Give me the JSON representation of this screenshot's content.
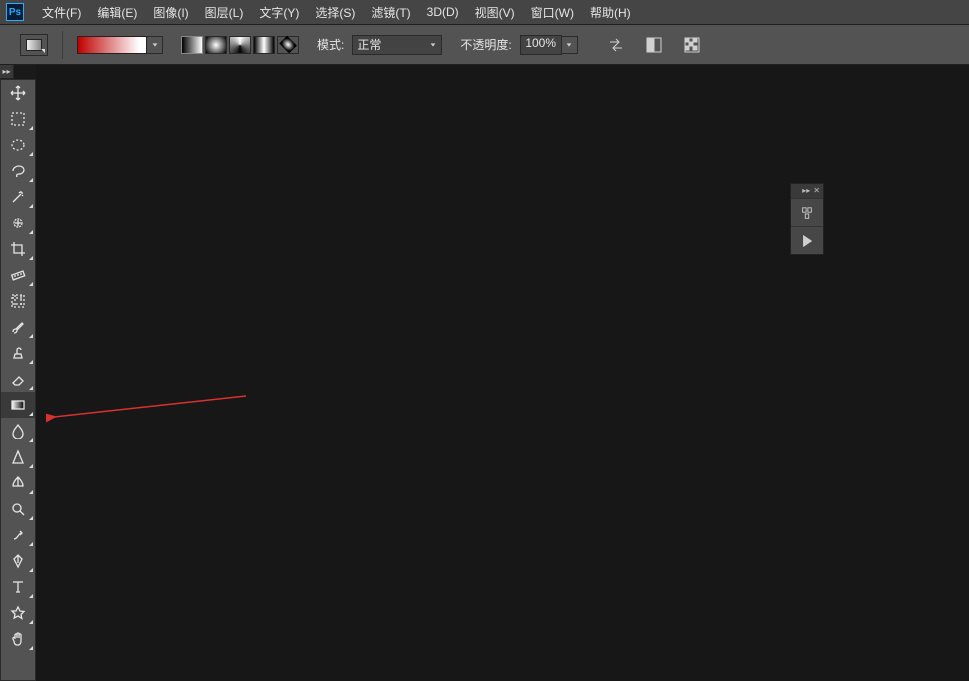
{
  "app": {
    "logo": "Ps"
  },
  "menu": {
    "items": [
      "文件(F)",
      "编辑(E)",
      "图像(I)",
      "图层(L)",
      "文字(Y)",
      "选择(S)",
      "滤镜(T)",
      "3D(D)",
      "视图(V)",
      "窗口(W)",
      "帮助(H)"
    ]
  },
  "options": {
    "mode_label": "模式:",
    "mode_value": "正常",
    "opacity_label": "不透明度:",
    "opacity_value": "100%"
  },
  "tools": [
    {
      "name": "move-tool",
      "fly": false
    },
    {
      "name": "rect-marquee-tool",
      "fly": true
    },
    {
      "name": "ellipse-marquee-tool",
      "fly": true
    },
    {
      "name": "lasso-tool",
      "fly": true
    },
    {
      "name": "magic-wand-tool",
      "fly": true
    },
    {
      "name": "quick-select-tool",
      "fly": true
    },
    {
      "name": "crop-tool",
      "fly": true
    },
    {
      "name": "ruler-eyedropper-tool",
      "fly": true
    },
    {
      "name": "frame-tool",
      "fly": false
    },
    {
      "name": "brush-tool",
      "fly": true
    },
    {
      "name": "clone-stamp-tool",
      "fly": true
    },
    {
      "name": "eraser-tool",
      "fly": true
    },
    {
      "name": "gradient-tool",
      "fly": true,
      "selected": true
    },
    {
      "name": "blur-tool",
      "fly": true
    },
    {
      "name": "sharpen-tool",
      "fly": true
    },
    {
      "name": "pen-tool",
      "fly": true
    },
    {
      "name": "dodge-tool",
      "fly": true
    },
    {
      "name": "smudge-tool",
      "fly": true
    },
    {
      "name": "path-pen-tool",
      "fly": true
    },
    {
      "name": "type-tool",
      "fly": true
    },
    {
      "name": "shape-tool",
      "fly": true
    },
    {
      "name": "hand-tool",
      "fly": true
    }
  ],
  "panel": {
    "collapse": "▸▸",
    "close": "✕"
  }
}
